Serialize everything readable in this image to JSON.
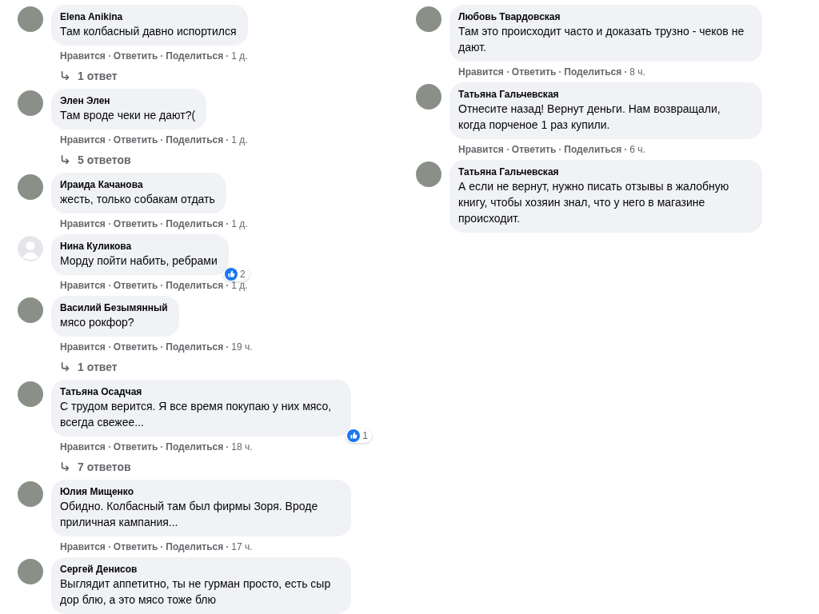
{
  "columns": [
    {
      "comments": [
        {
          "author": "Elena Anikina",
          "default_avatar": false,
          "text": "Там колбасный давно испортился",
          "actions": [
            "Нравится",
            "Ответить",
            "Поделиться"
          ],
          "time": "1 д.",
          "replies": "1 ответ"
        },
        {
          "author": "Элен Элен",
          "default_avatar": false,
          "text": "Там вроде чеки не дают?(",
          "actions": [
            "Нравится",
            "Ответить",
            "Поделиться"
          ],
          "time": "1 д.",
          "replies": "5 ответов"
        },
        {
          "author": "Ираида Качанова",
          "default_avatar": false,
          "text": "жесть, только собакам отдать",
          "actions": [
            "Нравится",
            "Ответить",
            "Поделиться"
          ],
          "time": "1 д."
        },
        {
          "author": "Нина Куликова",
          "default_avatar": true,
          "text": "Морду пойти набить, ребрами",
          "actions": [
            "Нравится",
            "Ответить",
            "Поделиться"
          ],
          "time": "1 д.",
          "reactions": "2"
        },
        {
          "author": "Василий Безымянный",
          "default_avatar": false,
          "text": "мясо рокфор?",
          "actions": [
            "Нравится",
            "Ответить",
            "Поделиться"
          ],
          "time": "19 ч.",
          "replies": "1 ответ"
        },
        {
          "author": "Татьяна Осадчая",
          "default_avatar": false,
          "text": "С трудом верится. Я все время покупаю у них мясо, всегда свежее...",
          "actions": [
            "Нравится",
            "Ответить",
            "Поделиться"
          ],
          "time": "18 ч.",
          "reactions": "1",
          "replies": "7 ответов"
        },
        {
          "author": "Юлия Мищенко",
          "default_avatar": false,
          "text": "Обидно. Колбасный там был фирмы Зоря. Вроде приличная кампания...",
          "actions": [
            "Нравится",
            "Ответить",
            "Поделиться"
          ],
          "time": "17 ч."
        },
        {
          "author": "Сергей Денисов",
          "default_avatar": false,
          "text": "Выглядит аппетитно, ты не гурман просто, есть сыр дор блю, а это мясо тоже блю"
        }
      ]
    },
    {
      "comments": [
        {
          "author": "Любовь Твардовская",
          "default_avatar": false,
          "text": "Там это происходит часто и доказать трузно - чеков не дают.",
          "actions": [
            "Нравится",
            "Ответить",
            "Поделиться"
          ],
          "time": "8 ч."
        },
        {
          "author": "Татьяна Гальчевская",
          "default_avatar": false,
          "text": "Отнесите назад! Вернут деньги. Нам возвращали, когда порченое 1 раз купили.",
          "actions": [
            "Нравится",
            "Ответить",
            "Поделиться"
          ],
          "time": "6 ч."
        },
        {
          "author": "Татьяна Гальчевская",
          "default_avatar": false,
          "text": "А если не вернут, нужно писать отзывы в жалобную книгу, чтобы хозяин знал, что у него в магазине происходит."
        }
      ]
    }
  ]
}
